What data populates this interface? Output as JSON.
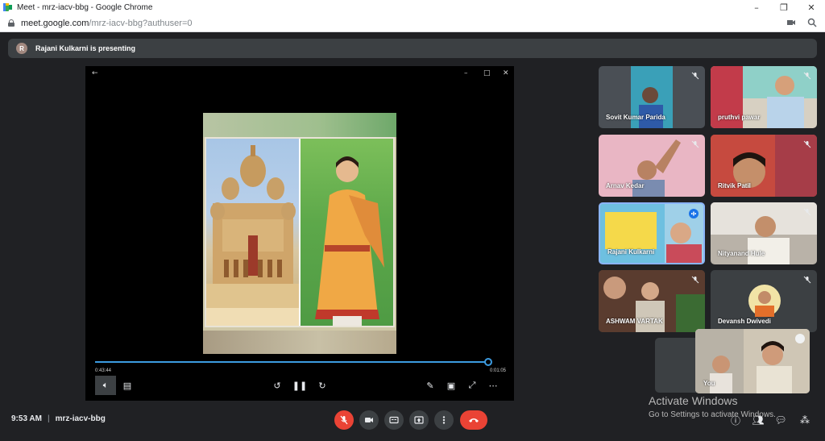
{
  "browser": {
    "tab_title": "Meet - mrz-iacv-bbg - Google Chrome",
    "url_host": "meet.google.com",
    "url_path": "/mrz-iacv-bbg?authuser=0"
  },
  "banner": {
    "avatar_initial": "R",
    "text": "Rajani Kulkarni is presenting"
  },
  "player": {
    "elapsed": "0:43:44",
    "duration": "0:01:05",
    "progress_fraction": 0.99
  },
  "participants": [
    {
      "name": "Sovit Kumar Parida",
      "muted": true
    },
    {
      "name": "pruthvi pawar",
      "muted": true
    },
    {
      "name": "Arnav Kedar",
      "muted": true
    },
    {
      "name": "Ritvik Patil",
      "muted": true
    },
    {
      "name": "Rajani Kulkarni",
      "muted": false,
      "speaking": true
    },
    {
      "name": "Nityanand Hule",
      "muted": true
    },
    {
      "name": "ASHWAM VARTAK",
      "muted": true
    },
    {
      "name": "Devansh Dwivedi",
      "muted": true
    }
  ],
  "self_view": {
    "label": "You"
  },
  "meeting": {
    "time": "9:53 AM",
    "separator": "|",
    "code": "mrz-iacv-bbg"
  },
  "watermark": {
    "line1": "Activate Windows",
    "line2": "Go to Settings to activate Windows."
  },
  "colors": {
    "background": "#202124",
    "tile": "#3c4043",
    "danger": "#ea4335",
    "accent": "#3c9be0"
  }
}
